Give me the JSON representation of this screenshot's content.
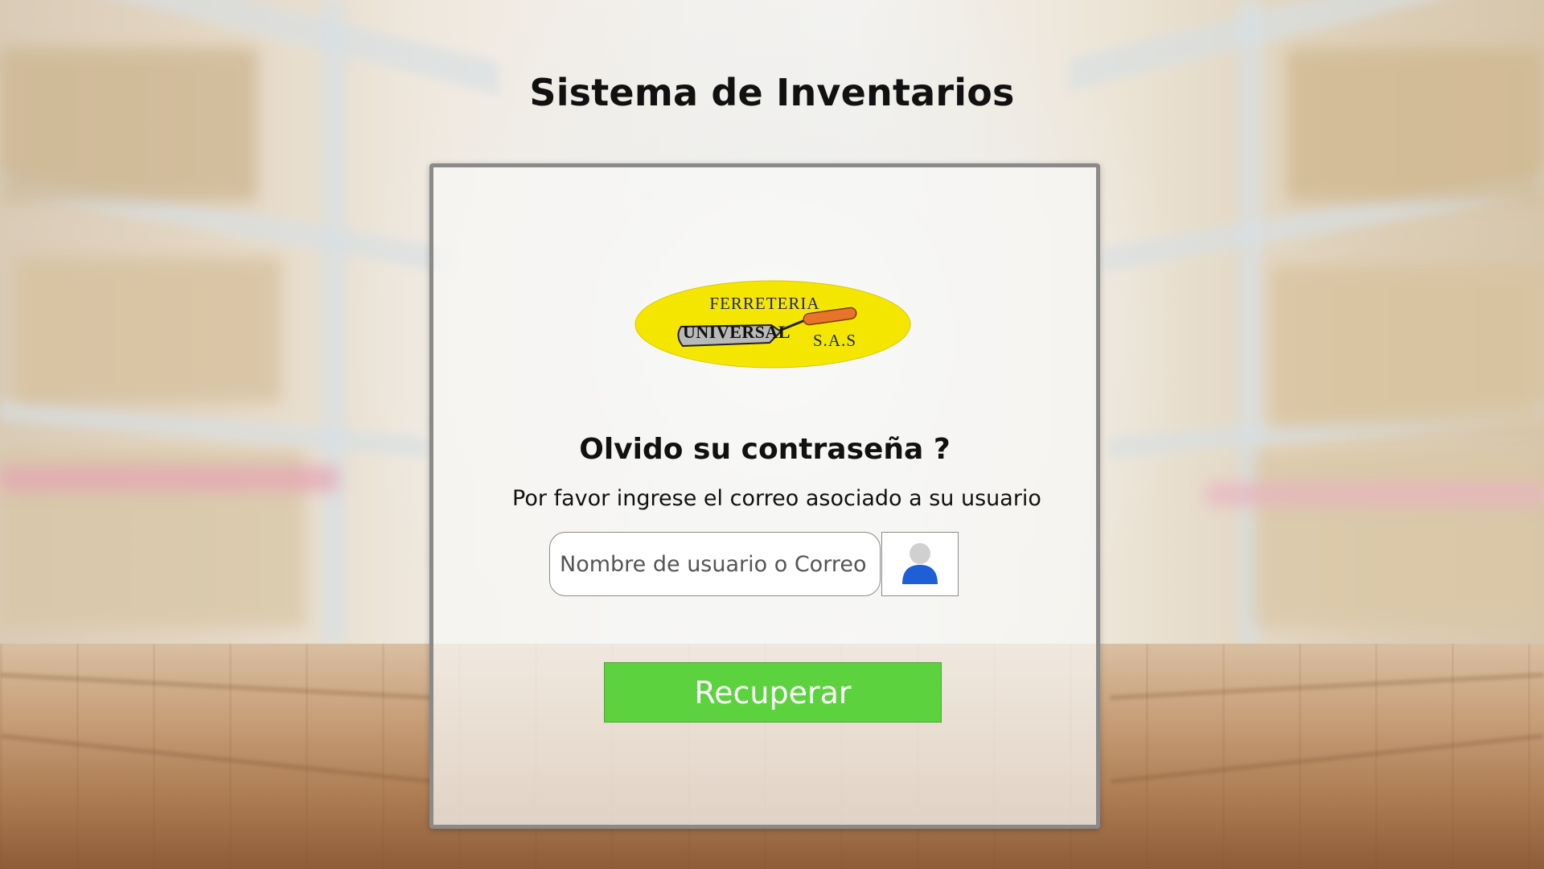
{
  "page": {
    "title": "Sistema de Inventarios"
  },
  "logo": {
    "line_top": "FERRETERIA",
    "line_brand": "UNIVERSAL",
    "line_suffix": "S.A.S",
    "colors": {
      "oval": "#f5e600",
      "text": "#1b2a6b",
      "trowel_handle": "#e8732a"
    }
  },
  "form": {
    "heading": "Olvido su contraseña ?",
    "subtitle": "Por favor ingrese el correo asociado a su usuario",
    "username_placeholder": "Nombre de usuario o Correo",
    "username_value": "",
    "user_icon": "user-icon",
    "submit_label": "Recuperar"
  },
  "colors": {
    "button": "#5dd23f",
    "user_icon": "#1f5fd6",
    "card_border": "#8a8a8a"
  }
}
